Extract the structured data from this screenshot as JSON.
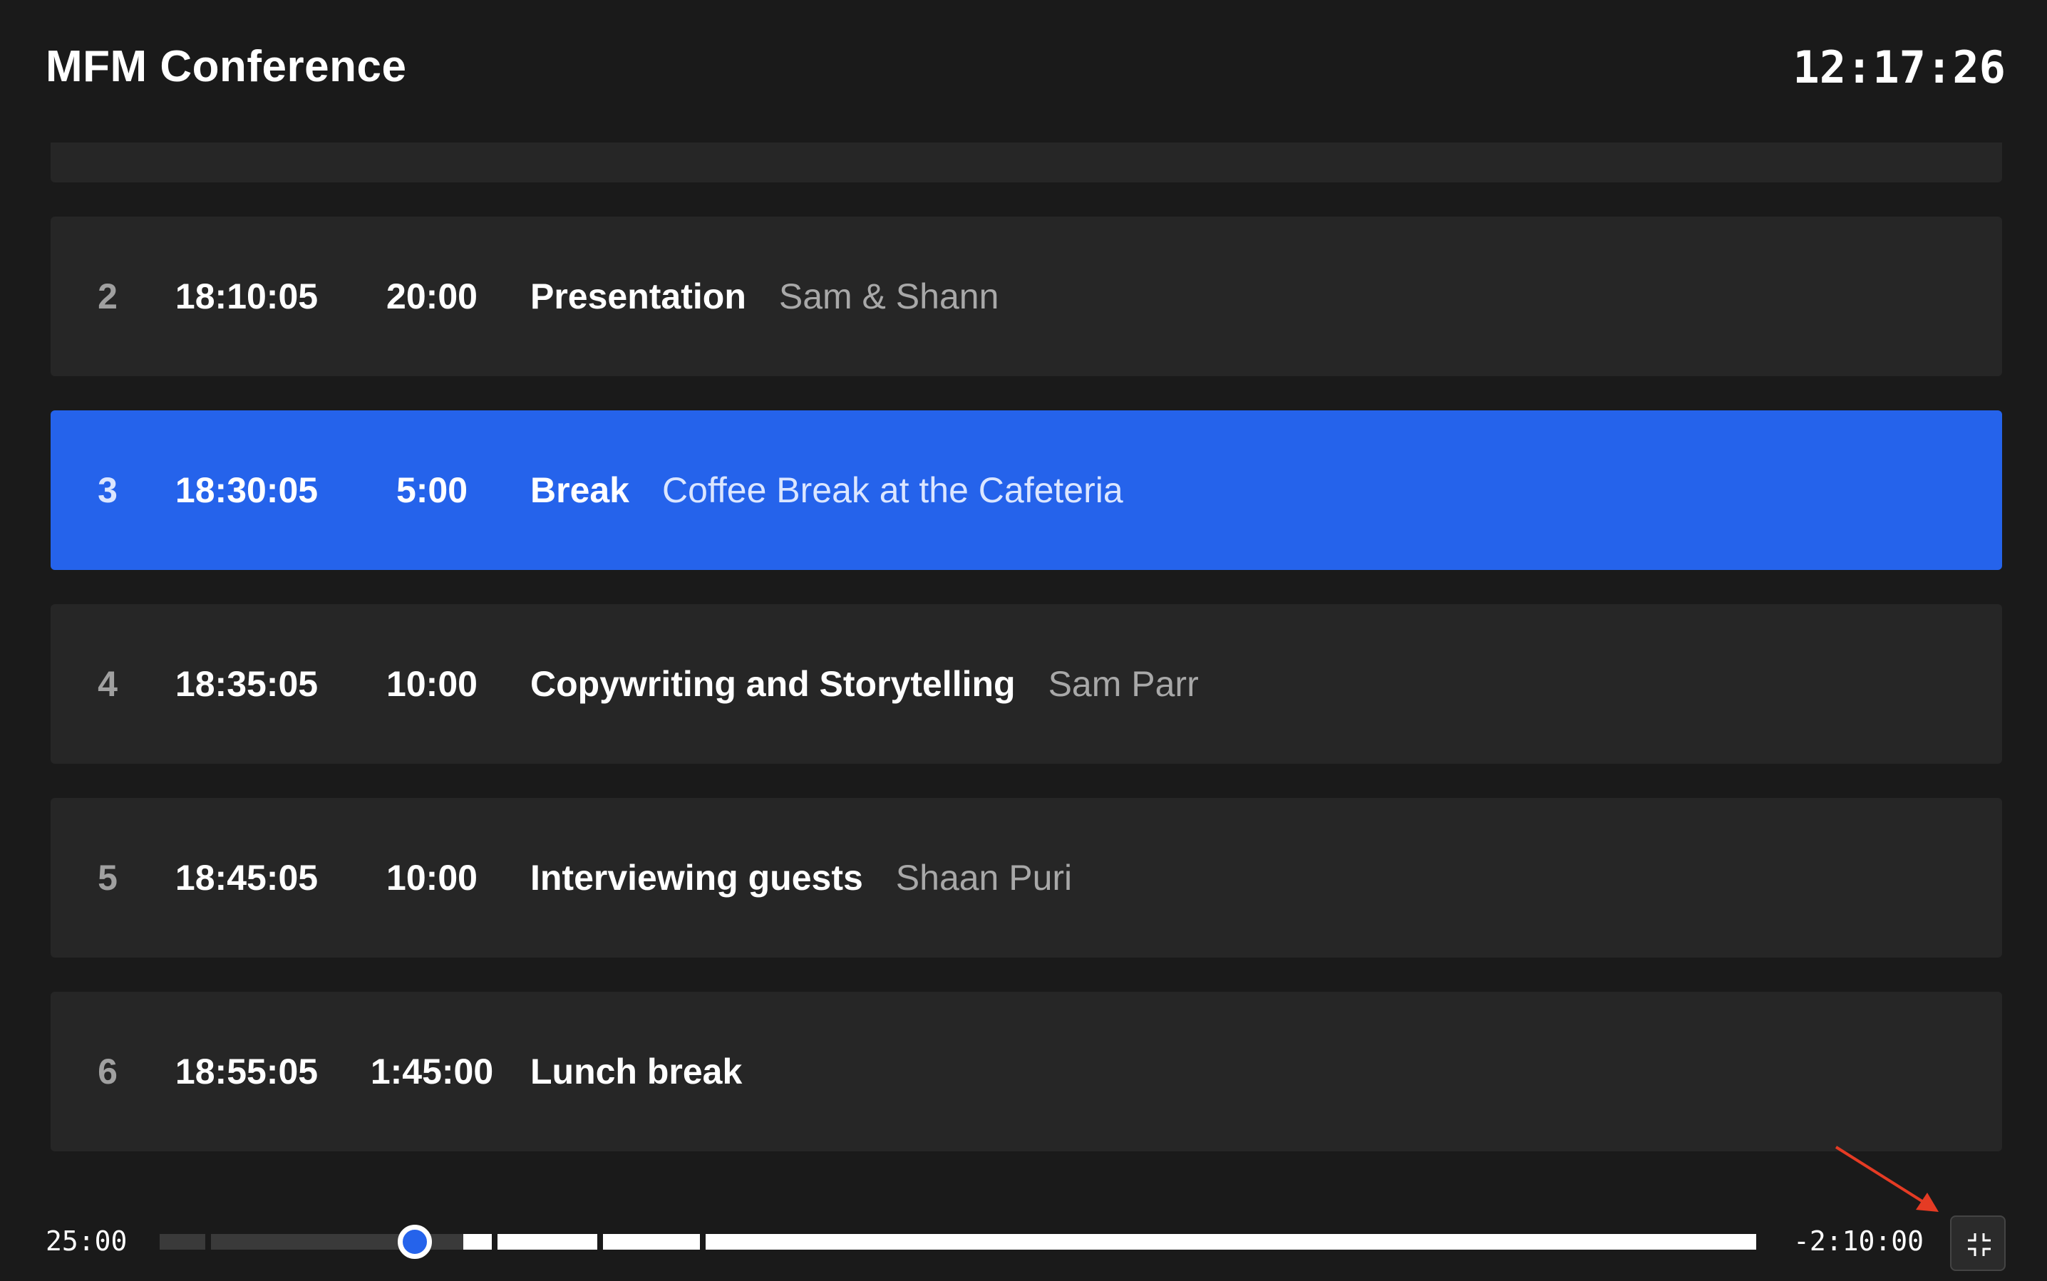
{
  "header": {
    "title": "MFM Conference",
    "clock": "12:17:26"
  },
  "rows": [
    {
      "num": "2",
      "start": "18:10:05",
      "duration": "20:00",
      "title": "Presentation",
      "subtitle": "Sam & Shann"
    },
    {
      "num": "3",
      "start": "18:30:05",
      "duration": "5:00",
      "title": "Break",
      "subtitle": "Coffee Break at the Cafeteria"
    },
    {
      "num": "4",
      "start": "18:35:05",
      "duration": "10:00",
      "title": "Copywriting and Storytelling",
      "subtitle": "Sam Parr"
    },
    {
      "num": "5",
      "start": "18:45:05",
      "duration": "10:00",
      "title": "Interviewing guests",
      "subtitle": "Shaan Puri"
    },
    {
      "num": "6",
      "start": "18:55:05",
      "duration": "1:45:00",
      "title": "Lunch break",
      "subtitle": ""
    }
  ],
  "active_row": 1,
  "footer": {
    "elapsed": "25:00",
    "remaining": "-2:10:00",
    "progress_fraction": 0.16
  },
  "colors": {
    "accent": "#2563eb",
    "row_bg": "#262626",
    "page_bg": "#1a1a1a",
    "annotation": "#e53b24"
  },
  "icons": {
    "fullscreen_button": "exit-fullscreen-icon"
  }
}
